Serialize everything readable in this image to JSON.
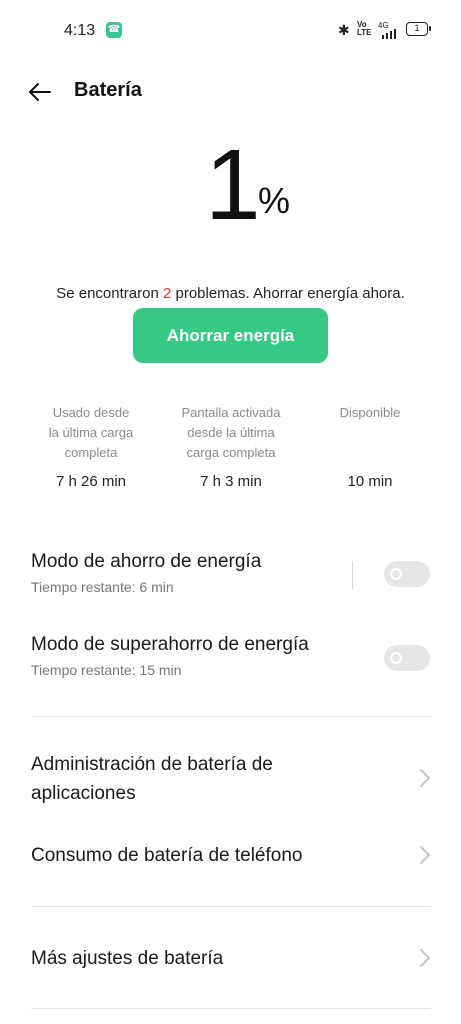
{
  "status_bar": {
    "time": "4:13",
    "network": "4G",
    "volte": "Vo LTE",
    "battery_level": "1",
    "icons": [
      "phone-call-icon",
      "bluetooth-icon",
      "volte-icon",
      "signal-4g-icon",
      "battery-icon"
    ]
  },
  "header": {
    "title": "Batería",
    "back_icon": "arrow-left-icon"
  },
  "battery": {
    "percent_value": "1",
    "percent_sign": "%"
  },
  "problems": {
    "prefix": "Se encontraron ",
    "count": "2",
    "suffix": " problemas. Ahorrar energía ahora."
  },
  "save_button_label": "Ahorrar energía",
  "stats": [
    {
      "label_lines": [
        "Usado desde",
        "la última carga",
        "completa"
      ],
      "value": "7 h 26 min"
    },
    {
      "label_lines": [
        "Pantalla activada",
        "desde la última",
        "carga completa"
      ],
      "value": "7 h 3 min"
    },
    {
      "label_lines": [
        "Disponible"
      ],
      "value": "10 min"
    }
  ],
  "toggles": [
    {
      "title": "Modo de ahorro de energía",
      "subtitle": "Tiempo restante:  6 min",
      "enabled": false
    },
    {
      "title": "Modo de superahorro de energía",
      "subtitle": "Tiempo restante:  15 min",
      "enabled": false
    }
  ],
  "nav_items": [
    {
      "title": "Administración de batería de aplicaciones"
    },
    {
      "title": "Consumo de batería de teléfono"
    },
    {
      "title": "Más ajustes de batería"
    }
  ],
  "colors": {
    "accent_green": "#35c984",
    "problem_red": "#e53935",
    "toggle_off": "#e6e6e6"
  }
}
